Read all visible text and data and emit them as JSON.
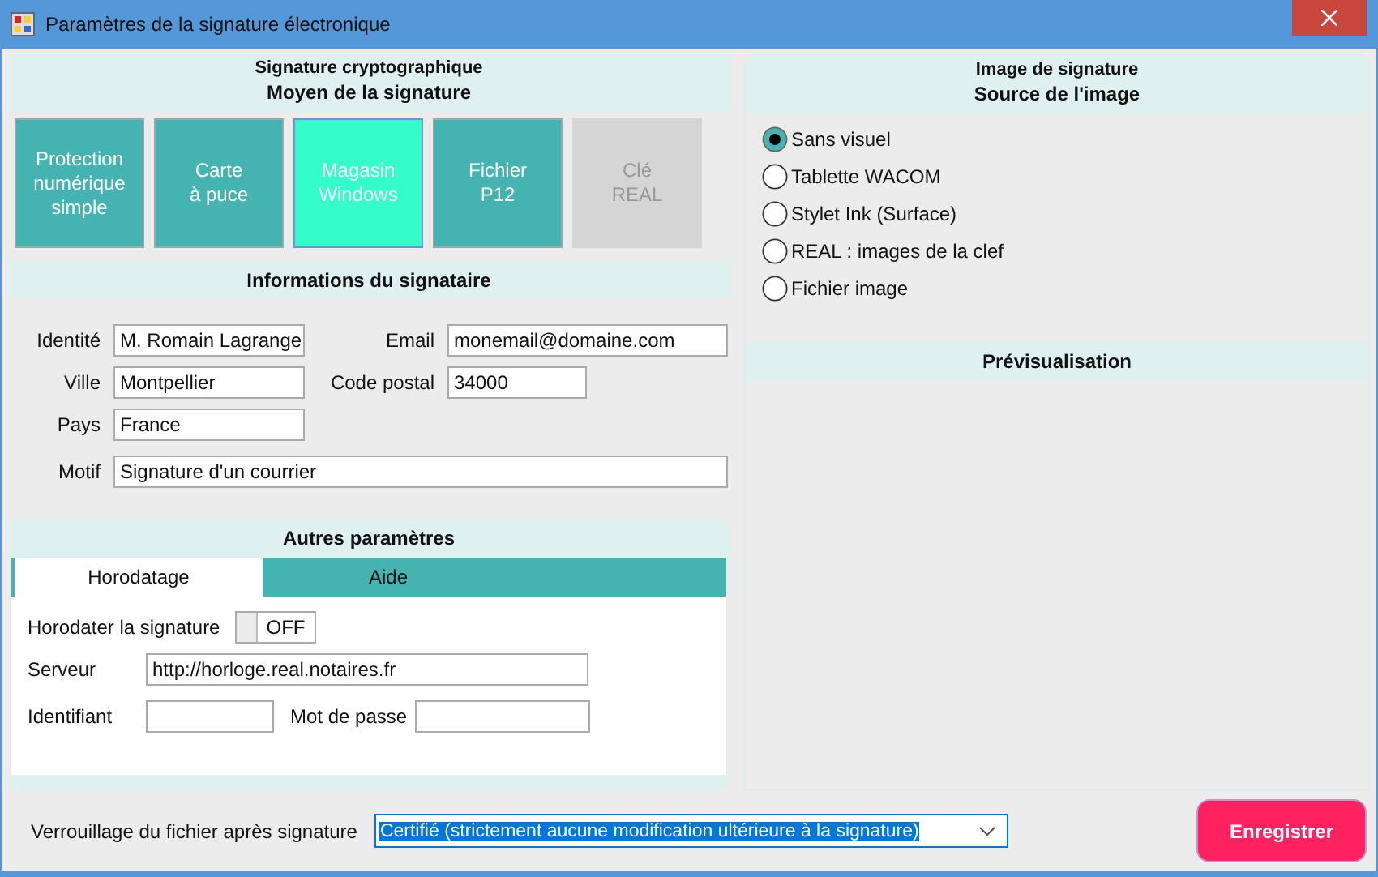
{
  "window": {
    "title": "Paramètres de la signature électronique"
  },
  "signature": {
    "title": "Signature cryptographique",
    "subtitle": "Moyen de la signature",
    "methods": [
      {
        "label": "Protection\nnumérique\nsimple",
        "selected": false,
        "disabled": false
      },
      {
        "label": "Carte\nà puce",
        "selected": false,
        "disabled": false
      },
      {
        "label": "Magasin\nWindows",
        "selected": true,
        "disabled": false
      },
      {
        "label": "Fichier\nP12",
        "selected": false,
        "disabled": false
      },
      {
        "label": "Clé\nREAL",
        "selected": false,
        "disabled": true
      }
    ]
  },
  "signer": {
    "title": "Informations du signataire",
    "fields": [
      {
        "label": "Identité",
        "value": "M. Romain Lagrange"
      },
      {
        "label": "Email",
        "value": "monemail@domaine.com"
      },
      {
        "label": "Ville",
        "value": "Montpellier"
      },
      {
        "label": "Code postal",
        "value": "34000"
      },
      {
        "label": "Pays",
        "value": "France"
      },
      {
        "label": "Motif",
        "value": "Signature d'un courrier"
      }
    ]
  },
  "other": {
    "title": "Autres paramètres",
    "tabs": [
      {
        "label": "Horodatage",
        "selected": true
      },
      {
        "label": "Aide",
        "selected": false
      }
    ],
    "timestamp": {
      "label": "Horodater la signature",
      "on": false,
      "state_text": "OFF"
    },
    "fields": [
      {
        "label": "Serveur",
        "value": "http://horloge.real.notaires.fr"
      },
      {
        "label": "Identifiant"
      },
      {
        "label": "Mot de passe"
      }
    ]
  },
  "image": {
    "title": "Image de signature",
    "subtitle": "Source de l'image",
    "sources": [
      {
        "label": "Sans visuel",
        "selected": true
      },
      {
        "label": "Tablette WACOM",
        "selected": false
      },
      {
        "label": "Stylet Ink (Surface)",
        "selected": false
      },
      {
        "label": "REAL : images de la clef",
        "selected": false
      },
      {
        "label": "Fichier image",
        "selected": false
      }
    ],
    "preview_title": "Prévisualisation"
  },
  "lock": {
    "label": "Verrouillage du fichier après signature",
    "value": "Certifié (strictement aucune modification ultérieure à la signature)"
  },
  "save_button": "Enregistrer"
}
